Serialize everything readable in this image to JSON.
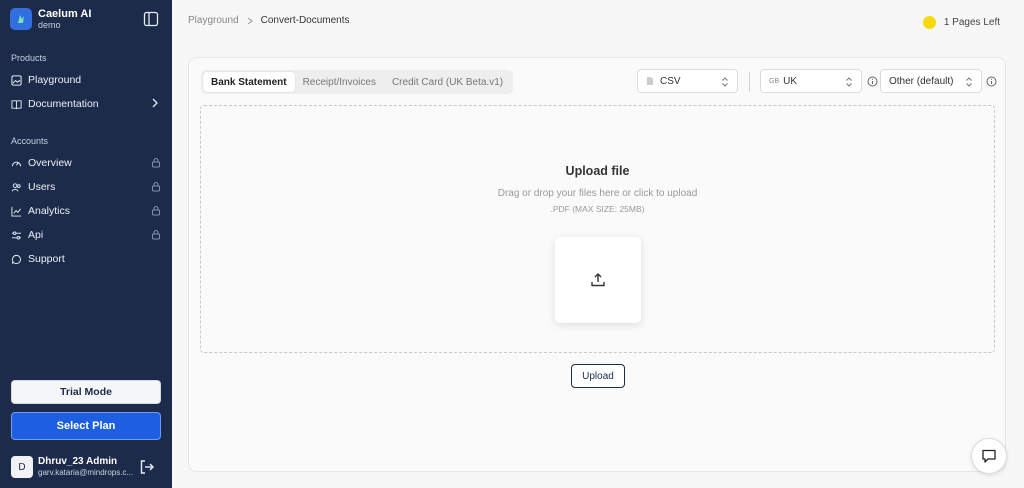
{
  "sidebar": {
    "brand": {
      "name": "Caelum AI",
      "sub": "demo"
    },
    "sections": {
      "products": "Products",
      "accounts": "Accounts"
    },
    "products_items": [
      {
        "label": "Playground",
        "icon": "image-icon"
      },
      {
        "label": "Documentation",
        "icon": "book-icon"
      }
    ],
    "accounts_items": [
      {
        "label": "Overview",
        "icon": "gauge-icon",
        "locked": true
      },
      {
        "label": "Users",
        "icon": "users-icon",
        "locked": true
      },
      {
        "label": "Analytics",
        "icon": "chart-icon",
        "locked": true
      },
      {
        "label": "Api",
        "icon": "sliders-icon",
        "locked": true
      },
      {
        "label": "Support",
        "icon": "chat-icon",
        "locked": false
      }
    ],
    "trial_label": "Trial Mode",
    "select_plan_label": "Select Plan",
    "user": {
      "initial": "D",
      "name": "Dhruv_23 Admin",
      "email": "garv.kataria@mindrops.c..."
    }
  },
  "header": {
    "breadcrumb": [
      "Playground",
      "Convert-Documents"
    ],
    "pages_left": "1 Pages Left"
  },
  "main": {
    "tabs": [
      {
        "label": "Bank Statement",
        "active": true
      },
      {
        "label": "Receipt/Invoices",
        "active": false
      },
      {
        "label": "Credit Card (UK Beta.v1)",
        "active": false
      }
    ],
    "format_select": "CSV",
    "country_select": {
      "code": "GB",
      "label": "UK"
    },
    "bank_select": "Other (default)",
    "dropzone": {
      "title": "Upload file",
      "subtitle": "Drag or drop your files here or click to upload",
      "note": ".PDF (MAX SIZE: 25MB)"
    },
    "upload_button": "Upload"
  },
  "colors": {
    "sidebar": "#1c2b4a",
    "primary": "#1d5fe0",
    "indicator": "#f5d90a"
  }
}
